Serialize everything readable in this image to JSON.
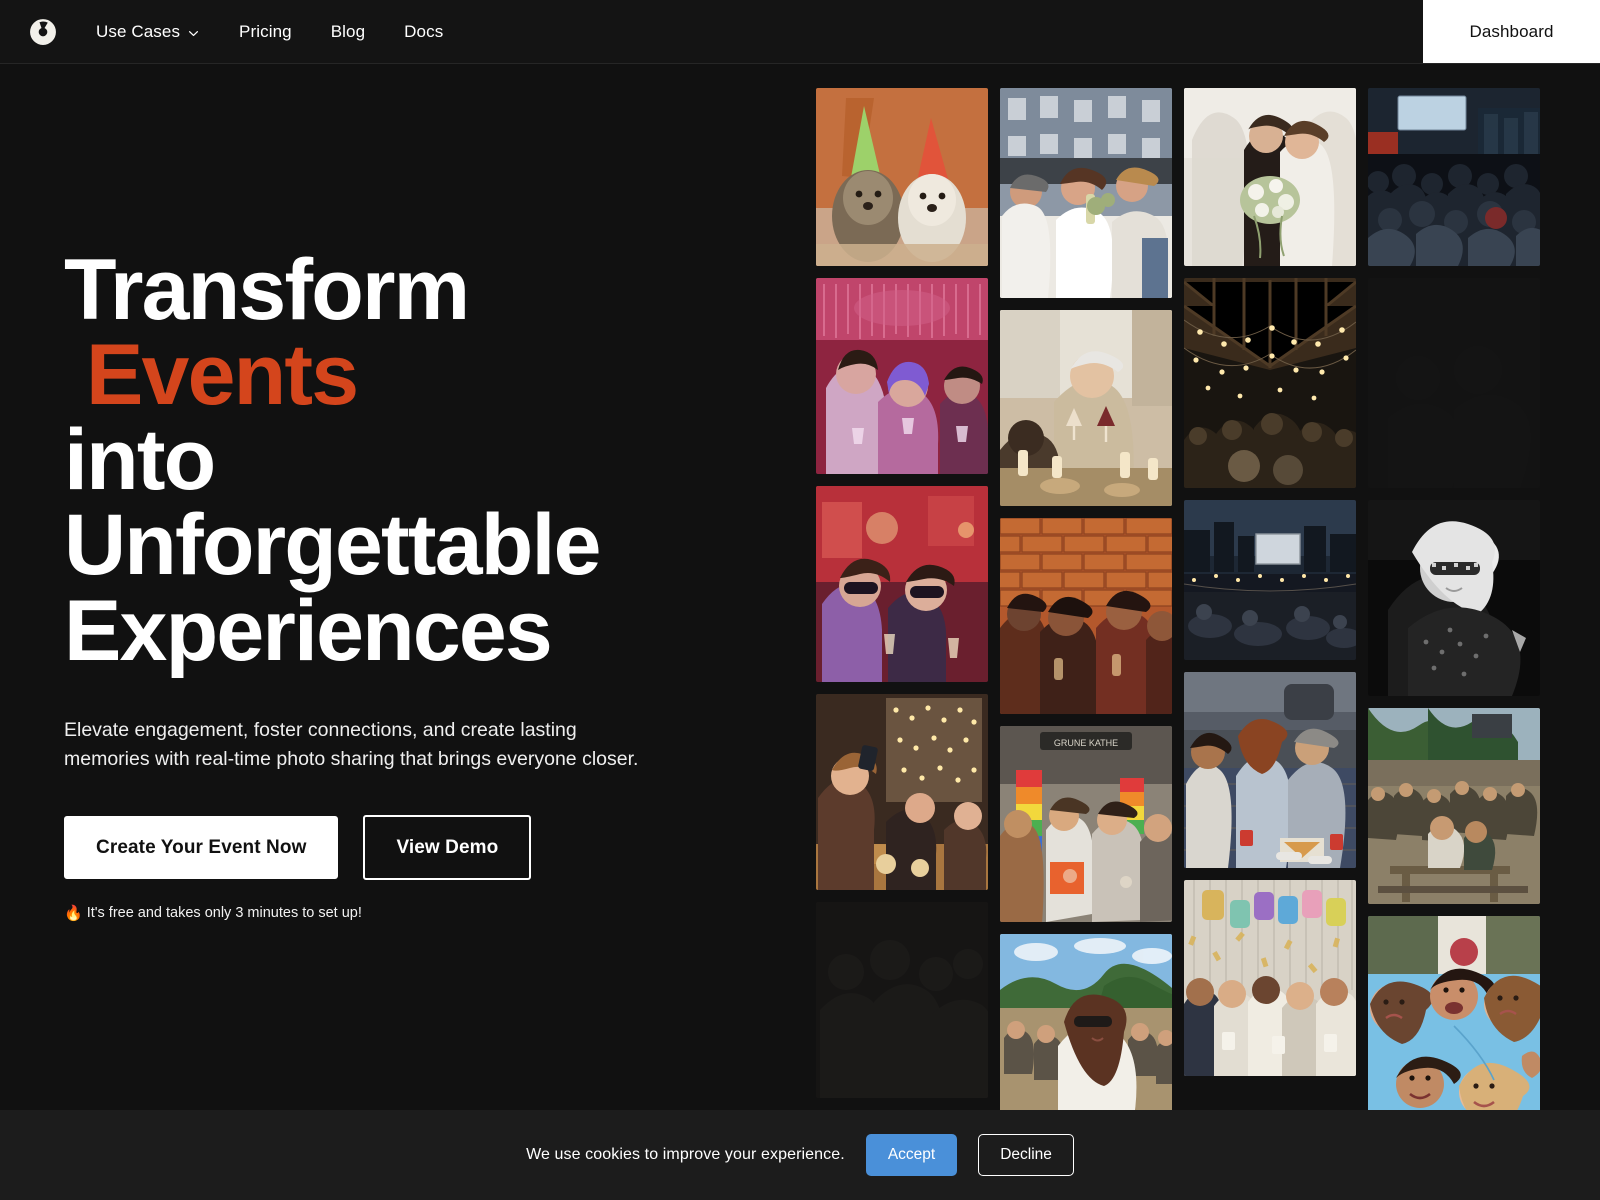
{
  "colors": {
    "page_bg": "#111111",
    "nav_bg": "#141414",
    "accent_orange": "#d4451c",
    "cookie_accept_blue": "#4a90d9",
    "cookie_bar_bg": "#1c1c1c",
    "text_white": "#ffffff"
  },
  "navbar": {
    "logo_icon": "camera-aperture-icon",
    "links": [
      {
        "label": "Use Cases",
        "has_dropdown": true,
        "dropdown_icon": "chevron-down-icon"
      },
      {
        "label": "Pricing",
        "has_dropdown": false
      },
      {
        "label": "Blog",
        "has_dropdown": false
      },
      {
        "label": "Docs",
        "has_dropdown": false
      }
    ],
    "dashboard_label": "Dashboard"
  },
  "hero": {
    "title_line1": "Transform",
    "title_line2": "Events",
    "title_line3": "into",
    "title_line4": "Unforgettable",
    "title_line5": "Experiences",
    "subheading": "Elevate engagement, foster connections, and create lasting memories with real-time photo sharing that brings everyone closer.",
    "primary_cta": "Create Your Event Now",
    "secondary_cta": "View Demo",
    "free_note_icon": "🔥",
    "free_note": "It's free and takes only 3 minutes to set up!"
  },
  "photo_grid": {
    "columns": 4,
    "tiles": [
      {
        "id": "two-dogs-party-hats",
        "alt": "Two terrier dogs wearing green and red party hats against orange wall"
      },
      {
        "id": "rooftop-dinner-party",
        "alt": "Friends laughing around a long white table at a rooftop dinner party"
      },
      {
        "id": "wedding-couple-bouquet",
        "alt": "Bride holding bouquet embracing groom in bright white room"
      },
      {
        "id": "conference-audience",
        "alt": "Large audience seated facing a lit stage at a conference"
      },
      {
        "id": "neon-nightclub-toast",
        "alt": "Young people in wigs toasting drinks under pink neon lights"
      },
      {
        "id": "family-dinner-toast",
        "alt": "Older woman toasting wine glasses at a warm candlelit dinner"
      },
      {
        "id": "barn-string-lights",
        "alt": "Guests gathered under string lights in a dark wooden barn"
      },
      {
        "id": "empty-dark-tile",
        "alt": "Dark empty grid placeholder"
      },
      {
        "id": "masquerade-party",
        "alt": "Women in lace masquerade masks holding champagne under red light"
      },
      {
        "id": "brick-wall-party",
        "alt": "Friends dancing and drinking in front of an orange brick wall"
      },
      {
        "id": "outdoor-movie-night",
        "alt": "Outdoor movie screening at dusk with blankets and string lights"
      },
      {
        "id": "bw-disco-portrait",
        "alt": "Black and white photo of a blonde woman in sequins and sunglasses"
      },
      {
        "id": "christmas-selfie-dinner",
        "alt": "Woman taking a selfie at a festive dinner with fairy lights"
      },
      {
        "id": "pride-parade-crowd",
        "alt": "Crowd with rainbow flags at a pride street parade"
      },
      {
        "id": "picnic-pizza-friends",
        "alt": "Friends sitting on a rug outdoors eating pizza with red cups"
      },
      {
        "id": "beer-garden-crowd",
        "alt": "Busy outdoor beer garden with picnic tables and trees"
      },
      {
        "id": "dim-crowd-tile",
        "alt": "Very dark dimmed crowd photo"
      },
      {
        "id": "festival-sunglasses",
        "alt": "Smiling woman in sunglasses at a sunny outdoor festival"
      },
      {
        "id": "happy-birthday-confetti",
        "alt": "Group celebrating under gold confetti with HAPPY balloon letters"
      },
      {
        "id": "friends-circle-overhead",
        "alt": "Overhead shot of friends lying in a circle looking up at camera"
      }
    ]
  },
  "cookie_banner": {
    "message": "We use cookies to improve your experience.",
    "accept_label": "Accept",
    "decline_label": "Decline"
  }
}
